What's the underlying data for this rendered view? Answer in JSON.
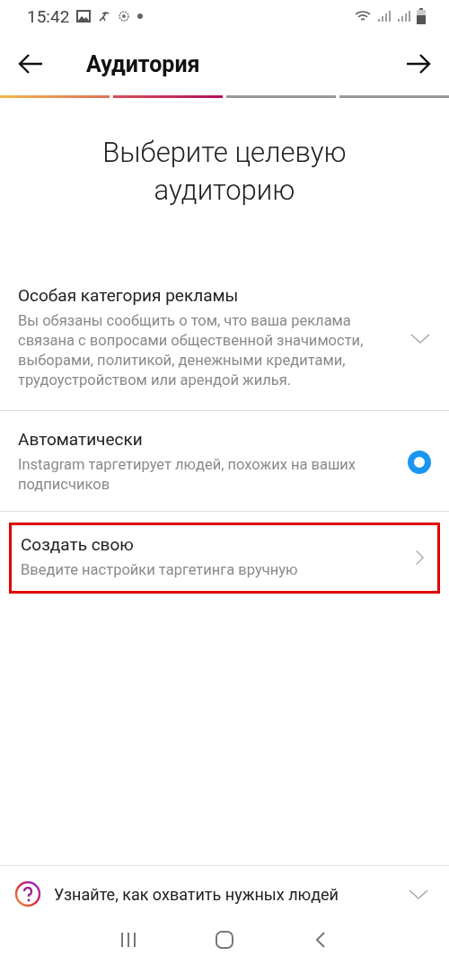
{
  "status_bar": {
    "time": "15:42"
  },
  "header": {
    "title": "Аудитория"
  },
  "progress": [
    {
      "done": true
    },
    {
      "done": true
    },
    {
      "done": false
    },
    {
      "done": false
    }
  ],
  "heading": "Выберите целевую аудиторию",
  "options": [
    {
      "kind": "expand",
      "title": "Особая категория рекламы",
      "description": "Вы обязаны сообщить о том, что ваша реклама связана с вопросами общественной значимости, выборами, политикой, денежными кредитами, трудоустройством или арендой жилья.",
      "highlighted": false
    },
    {
      "kind": "radio",
      "title": "Автоматически",
      "description": "Instagram таргетирует людей, похожих на ваших подписчиков",
      "selected": true,
      "highlighted": false
    },
    {
      "kind": "link",
      "title": "Создать свою",
      "description": "Введите настройки таргетинга вручную",
      "highlighted": true
    }
  ],
  "help": {
    "text": "Узнайте, как охватить нужных людей"
  }
}
